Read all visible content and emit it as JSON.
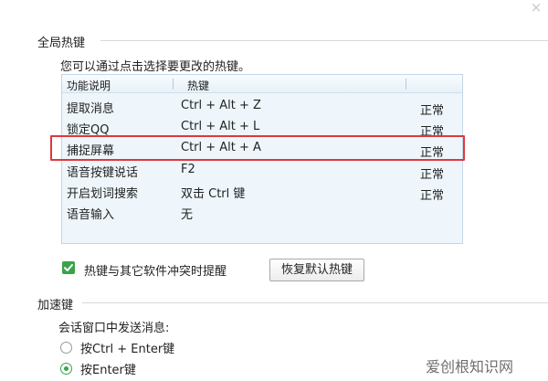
{
  "window": {
    "close_glyph": "×"
  },
  "global_hotkeys": {
    "section_title": "全局热键",
    "description": "您可以通过点击选择要更改的热键。",
    "table": {
      "columns": [
        "功能说明",
        "热键"
      ],
      "rows": [
        {
          "func": "提取消息",
          "key": "Ctrl + Alt + Z",
          "status": "正常"
        },
        {
          "func": "锁定QQ",
          "key": "Ctrl + Alt + L",
          "status": "正常"
        },
        {
          "func": "捕捉屏幕",
          "key": "Ctrl + Alt + A",
          "status": "正常",
          "highlighted": true
        },
        {
          "func": "语音按键说话",
          "key": "F2",
          "status": "正常"
        },
        {
          "func": "开启划词搜索",
          "key": "双击 Ctrl 键",
          "status": "正常"
        },
        {
          "func": "语音输入",
          "key": "无",
          "status": ""
        }
      ]
    },
    "conflict_reminder": {
      "label": "热键与其它软件冲突时提醒",
      "checked": true
    },
    "restore_button": "恢复默认热键"
  },
  "accelerator": {
    "section_title": "加速键",
    "send_label": "会话窗口中发送消息:",
    "options": [
      {
        "label": "按Ctrl + Enter键",
        "selected": false
      },
      {
        "label": "按Enter键",
        "selected": true
      }
    ]
  },
  "watermark": "爱创根知识网",
  "colors": {
    "highlight_border": "#e0383c",
    "check_green": "#3aa34a",
    "table_bg": "#eef6fb"
  }
}
